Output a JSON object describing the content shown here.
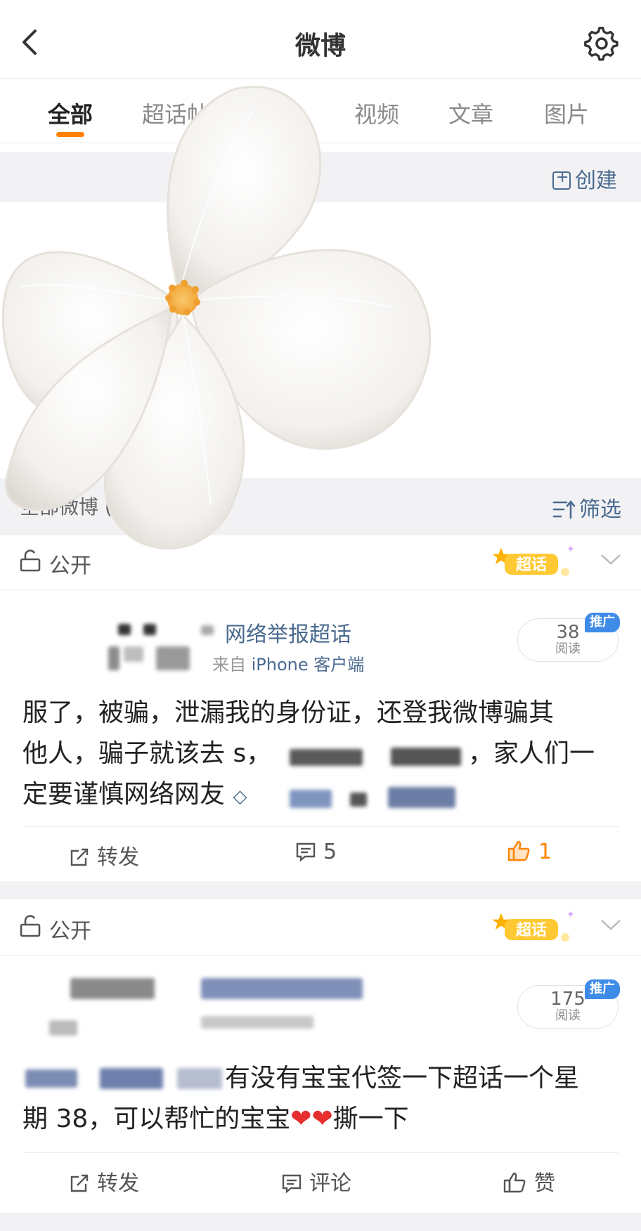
{
  "header": {
    "title": "微博"
  },
  "tabs": [
    {
      "label": "全部"
    },
    {
      "label": "超话帖"
    },
    {
      "label": "视频"
    },
    {
      "label": "文章"
    },
    {
      "label": "图片"
    }
  ],
  "groups": {
    "create_label": "创建"
  },
  "section": {
    "title": "全部微博 (",
    "filter_label": "筛选"
  },
  "posts": [
    {
      "visibility": "公开",
      "badge": "超话",
      "topic": "网络举报超话",
      "source_prefix": "来自 ",
      "source": "iPhone 客户端",
      "reads": "38",
      "reads_label": "阅读",
      "promo": "推广",
      "text_lines": [
        "服了，被骗，泄漏我的身份证，还登我微博骗其",
        "他人，骗子就该去 s，",
        "，家人们一",
        "定要谨慎网络网友"
      ],
      "repost_label": "转发",
      "comment_count": "5",
      "like_count": "1"
    },
    {
      "visibility": "公开",
      "badge": "超话",
      "reads": "175",
      "reads_label": "阅读",
      "promo": "推广",
      "text_part": "有没有宝宝代签一下超话一个星",
      "text_line2": "期 38，可以帮忙的宝宝",
      "text_tail": "撕一下",
      "repost_label": "转发",
      "comment_label": "评论",
      "like_label": "赞"
    }
  ]
}
